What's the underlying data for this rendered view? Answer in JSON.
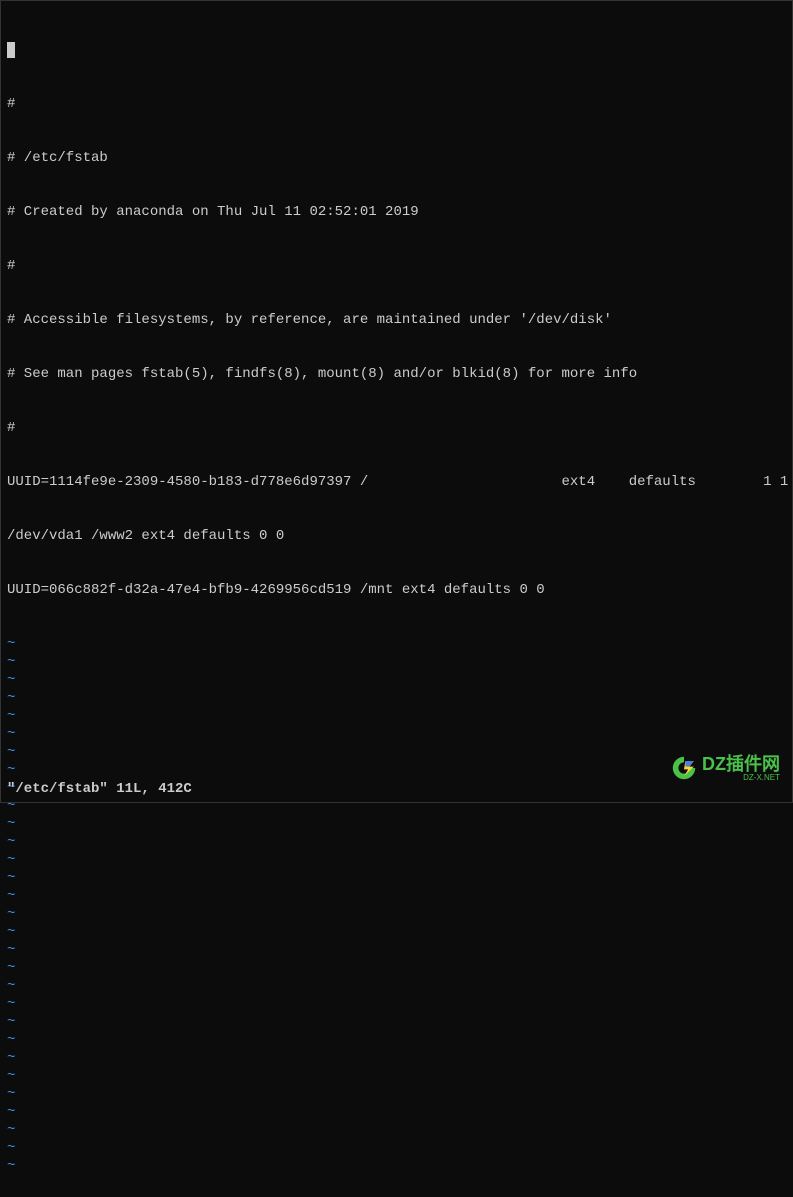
{
  "editor": {
    "cursor_visible": true,
    "lines": [
      "#",
      "# /etc/fstab",
      "# Created by anaconda on Thu Jul 11 02:52:01 2019",
      "#",
      "# Accessible filesystems, by reference, are maintained under '/dev/disk'",
      "# See man pages fstab(5), findfs(8), mount(8) and/or blkid(8) for more info",
      "#",
      "UUID=1114fe9e-2309-4580-b183-d778e6d97397 /                       ext4    defaults        1 1",
      "/dev/vda1 /www2 ext4 defaults 0 0",
      "UUID=066c882f-d32a-47e4-bfb9-4269956cd519 /mnt ext4 defaults 0 0"
    ],
    "tilde_count": 30,
    "tilde_char": "~"
  },
  "status": {
    "text": "\"/etc/fstab\" 11L, 412C"
  },
  "watermark": {
    "main": "DZ插件网",
    "sub": "DZ-X.NET"
  }
}
